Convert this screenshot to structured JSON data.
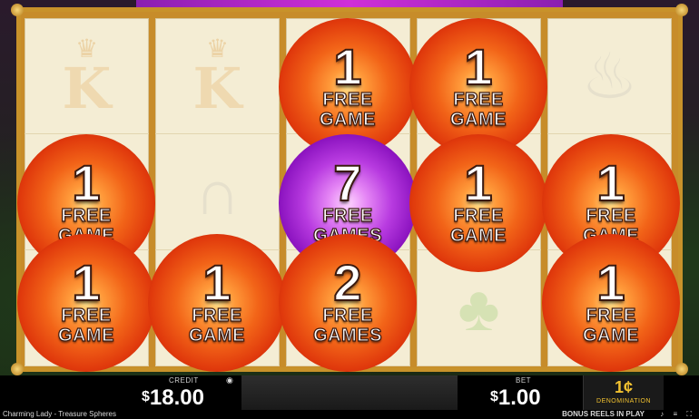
{
  "game": {
    "name": "Charming Lady - Treasure Spheres",
    "status": "BONUS REELS IN PLAY"
  },
  "reels": {
    "ghost_symbols": {
      "king_letter": "K",
      "crown_glyph": "♛",
      "horseshoe_glyph": "∩",
      "clover_glyph": "♣",
      "perfume_glyph": "♨"
    },
    "spheres": [
      {
        "count": "1",
        "label": "FREE",
        "label2": "GAME",
        "color": "orange"
      },
      {
        "count": "1",
        "label": "FREE",
        "label2": "GAME",
        "color": "orange"
      },
      {
        "count": "1",
        "label": "FREE",
        "label2": "GAME",
        "color": "orange"
      },
      {
        "count": "7",
        "label": "FREE",
        "label2": "GAMES",
        "color": "purple"
      },
      {
        "count": "1",
        "label": "FREE",
        "label2": "GAME",
        "color": "orange"
      },
      {
        "count": "1",
        "label": "FREE",
        "label2": "GAME",
        "color": "orange"
      },
      {
        "count": "1",
        "label": "FREE",
        "label2": "GAME",
        "color": "orange"
      },
      {
        "count": "1",
        "label": "FREE",
        "label2": "GAME",
        "color": "orange"
      },
      {
        "count": "2",
        "label": "FREE",
        "label2": "GAMES",
        "color": "orange"
      },
      {
        "count": "1",
        "label": "FREE",
        "label2": "GAME",
        "color": "orange"
      }
    ]
  },
  "credit": {
    "label": "CREDIT",
    "currency": "$",
    "amount": "18.00"
  },
  "bet": {
    "label": "BET",
    "currency": "$",
    "amount": "1.00"
  },
  "denomination": {
    "value": "1¢",
    "label": "DENOMINATION"
  },
  "status_icons": "♪ ≡ ⛶",
  "colors": {
    "frame_gold": "#c8922a",
    "sphere_orange": "#e0390c",
    "sphere_purple": "#8f16c2",
    "denom_gold": "#f2c230"
  }
}
